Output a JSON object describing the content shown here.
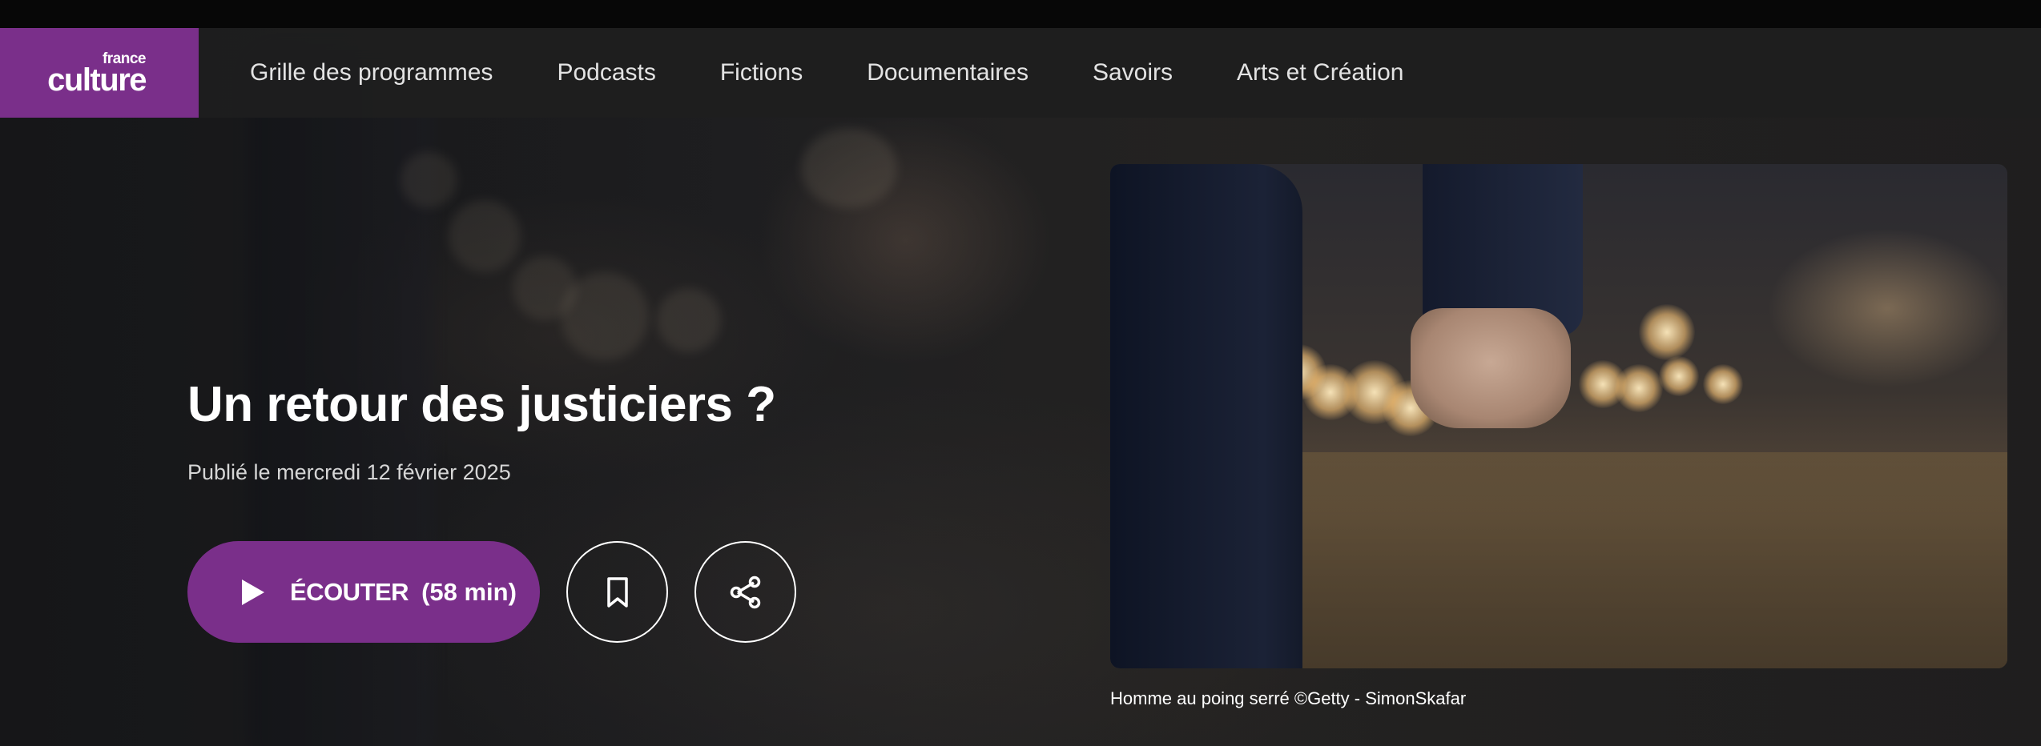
{
  "header": {
    "logo": {
      "line1": "france",
      "line2": "culture"
    },
    "nav": [
      {
        "label": "Grille des programmes"
      },
      {
        "label": "Podcasts"
      },
      {
        "label": "Fictions"
      },
      {
        "label": "Documentaires"
      },
      {
        "label": "Savoirs"
      },
      {
        "label": "Arts et Création"
      }
    ]
  },
  "episode": {
    "title": "Un retour des justiciers ?",
    "published": "Publié le mercredi 12 février 2025",
    "listen_label": "ÉCOUTER",
    "duration": "(58 min)"
  },
  "image": {
    "caption": "Homme au poing serré ©Getty - SimonSkafar"
  },
  "icons": {
    "play": "play-icon",
    "bookmark": "bookmark-icon",
    "share": "share-icon"
  },
  "colors": {
    "brand": "#7a2f8a",
    "header_bg": "#1e1e1e",
    "page_bg": "#1b1b1b"
  }
}
